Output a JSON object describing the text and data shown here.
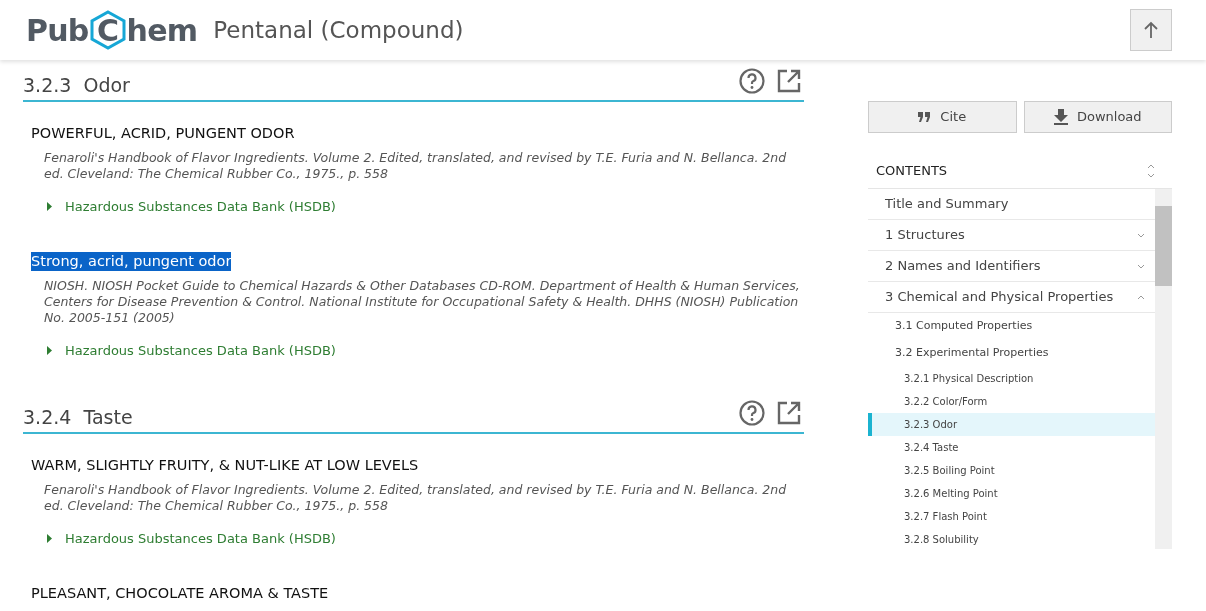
{
  "header": {
    "logo": {
      "left": "Pub",
      "middle": "C",
      "right": "hem"
    },
    "title": "Pentanal (Compound)"
  },
  "sections": [
    {
      "title": "3.2.3  Odor",
      "entries": [
        {
          "text": "POWERFUL, ACRID, PUNGENT ODOR",
          "highlighted": false,
          "citation": "Fenaroli's Handbook of Flavor Ingredients. Volume 2. Edited, translated, and revised by T.E. Furia and N. Bellanca. 2nd ed. Cleveland: The Chemical Rubber Co., 1975., p. 558",
          "source": "Hazardous Substances Data Bank (HSDB)"
        },
        {
          "text": "Strong, acrid, pungent odor",
          "highlighted": true,
          "citation": "NIOSH. NIOSH Pocket Guide to Chemical Hazards & Other Databases CD-ROM. Department of Health & Human Services, Centers for Disease Prevention & Control. National Institute for Occupational Safety & Health. DHHS (NIOSH) Publication No. 2005-151 (2005)",
          "source": "Hazardous Substances Data Bank (HSDB)"
        }
      ]
    },
    {
      "title": "3.2.4  Taste",
      "entries": [
        {
          "text": "WARM, SLIGHTLY FRUITY, & NUT-LIKE AT LOW LEVELS",
          "highlighted": false,
          "citation": "Fenaroli's Handbook of Flavor Ingredients. Volume 2. Edited, translated, and revised by T.E. Furia and N. Bellanca. 2nd ed. Cleveland: The Chemical Rubber Co., 1975., p. 558",
          "source": "Hazardous Substances Data Bank (HSDB)"
        },
        {
          "text": "PLEASANT, CHOCOLATE AROMA & TASTE",
          "highlighted": false
        }
      ]
    }
  ],
  "sidebar": {
    "buttons": [
      {
        "kind": "cite",
        "label": "Cite"
      },
      {
        "kind": "download",
        "label": "Download"
      }
    ],
    "contents": {
      "title": "CONTENTS",
      "items": [
        {
          "label": "Title and Summary",
          "selected": false
        },
        {
          "label": "1 Structures",
          "expanded": false,
          "selected": false
        },
        {
          "label": "2 Names and Identifiers",
          "expanded": false,
          "selected": false
        },
        {
          "label": "3 Chemical and Physical Properties",
          "expanded": true,
          "selected": false,
          "children": [
            {
              "label": "3.1 Computed Properties",
              "selected": false
            },
            {
              "label": "3.2 Experimental Properties",
              "selected": false,
              "children": [
                {
                  "label": "3.2.1 Physical Description",
                  "selected": false
                },
                {
                  "label": "3.2.2 Color/Form",
                  "selected": false
                },
                {
                  "label": "3.2.3 Odor",
                  "selected": true
                },
                {
                  "label": "3.2.4 Taste",
                  "selected": false
                },
                {
                  "label": "3.2.5 Boiling Point",
                  "selected": false
                },
                {
                  "label": "3.2.6 Melting Point",
                  "selected": false
                },
                {
                  "label": "3.2.7 Flash Point",
                  "selected": false
                },
                {
                  "label": "3.2.8 Solubility",
                  "selected": false
                }
              ]
            }
          ]
        }
      ]
    }
  }
}
